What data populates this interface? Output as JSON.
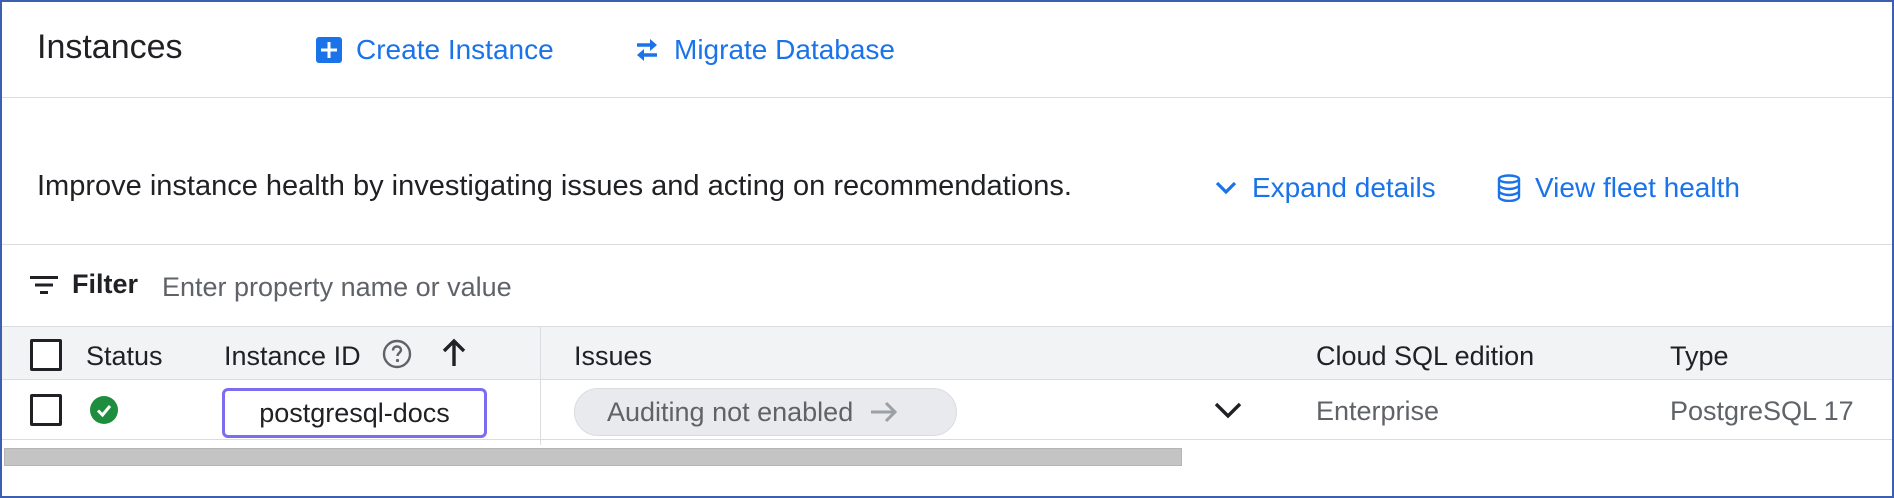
{
  "header": {
    "title": "Instances",
    "create_label": "Create Instance",
    "migrate_label": "Migrate Database"
  },
  "health": {
    "message": "Improve instance health by investigating issues and acting on recommendations.",
    "expand_label": "Expand details",
    "fleet_label": "View fleet health"
  },
  "filter": {
    "label": "Filter",
    "placeholder": "Enter property name or value"
  },
  "table": {
    "columns": {
      "status": "Status",
      "instance_id": "Instance ID",
      "issues": "Issues",
      "edition": "Cloud SQL edition",
      "type": "Type"
    },
    "rows": [
      {
        "status": "healthy",
        "instance_id": "postgresql-docs",
        "issue": "Auditing not enabled",
        "edition": "Enterprise",
        "type": "PostgreSQL 17"
      }
    ]
  },
  "colors": {
    "accent": "#1a73e8",
    "success": "#1e8e3e",
    "focus_outline": "#7c6cf0"
  },
  "icons": {
    "create": "add-box-icon",
    "migrate": "swap-arrows-icon",
    "expand": "chevron-down-icon",
    "fleet": "database-icon",
    "filter": "filter-lines-icon",
    "help": "help-circle-icon",
    "sort": "arrow-up-icon",
    "status_ok": "check-circle-icon",
    "issue_arrow": "arrow-right-icon",
    "row_expand": "chevron-down-icon"
  }
}
